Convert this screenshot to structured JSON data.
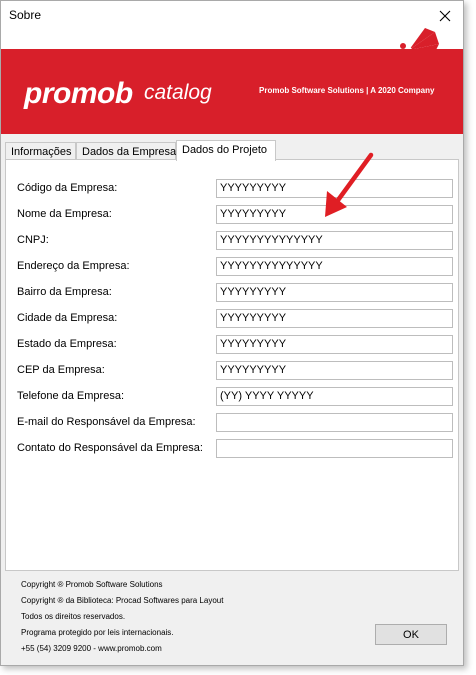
{
  "window": {
    "title": "Sobre",
    "close_icon": "close-icon"
  },
  "banner": {
    "brand": "promob",
    "product": "catalog",
    "company": "Promob Software Solutions | A 2020 Company",
    "color": "#d81f2a"
  },
  "tabs": [
    {
      "label": "Informações"
    },
    {
      "label": "Dados da Empresa"
    },
    {
      "label": "Dados do Projeto",
      "active": true
    }
  ],
  "fields": [
    {
      "label": "Código da Empresa:",
      "value": "YYYYYYYYY"
    },
    {
      "label": "Nome da Empresa:",
      "value": "YYYYYYYYY"
    },
    {
      "label": "CNPJ:",
      "value": "YYYYYYYYYYYYYY"
    },
    {
      "label": "Endereço da Empresa:",
      "value": "YYYYYYYYYYYYYY"
    },
    {
      "label": "Bairro da Empresa:",
      "value": "YYYYYYYYY"
    },
    {
      "label": "Cidade da Empresa:",
      "value": "YYYYYYYYY"
    },
    {
      "label": "Estado da Empresa:",
      "value": "YYYYYYYYY"
    },
    {
      "label": "CEP da Empresa:",
      "value": "YYYYYYYYY"
    },
    {
      "label": "Telefone da Empresa:",
      "value": "(YY) YYYY YYYYY"
    },
    {
      "label": "E-mail do Responsável da Empresa:",
      "value": ""
    },
    {
      "label": "Contato do Responsável da Empresa:",
      "value": ""
    }
  ],
  "footer": [
    "Copyright ® Promob Software Solutions",
    "Copyright ® da Biblioteca: Procad Softwares para Layout",
    "Todos os direitos reservados.",
    "Programa protegido por leis internacionais.",
    "+55 (54) 3209 9200  -  www.promob.com"
  ],
  "ok_label": "OK",
  "annotation_arrow_color": "#e01e24"
}
